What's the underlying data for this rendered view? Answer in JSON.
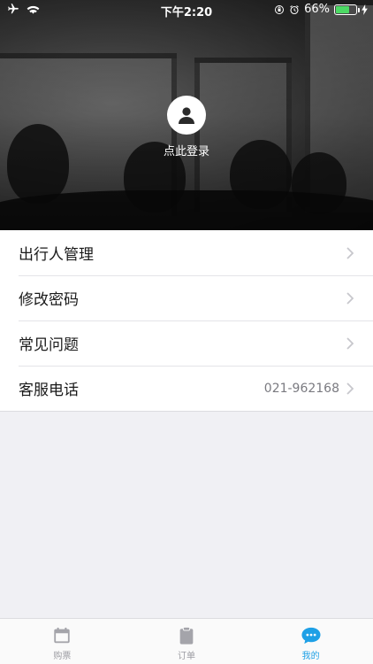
{
  "status_bar": {
    "time": "下午2:20",
    "battery_percent": "66%",
    "battery_level": 0.66,
    "icons": [
      "airplane-icon",
      "wifi-icon",
      "orientation-lock-icon",
      "alarm-icon",
      "battery-icon",
      "charging-icon"
    ]
  },
  "profile": {
    "login_label": "点此登录",
    "avatar_icon": "user-silhouette-icon"
  },
  "menu": {
    "items": [
      {
        "label": "出行人管理",
        "value": ""
      },
      {
        "label": "修改密码",
        "value": ""
      },
      {
        "label": "常见问题",
        "value": ""
      },
      {
        "label": "客服电话",
        "value": "021-962168"
      }
    ]
  },
  "tabbar": {
    "tabs": [
      {
        "label": "购票",
        "icon": "calendar-icon",
        "active": false
      },
      {
        "label": "订单",
        "icon": "clipboard-icon",
        "active": false
      },
      {
        "label": "我的",
        "icon": "chat-bubble-icon",
        "active": true
      }
    ],
    "active_color": "#1ea0e6",
    "inactive_color": "#9c9ca2"
  }
}
